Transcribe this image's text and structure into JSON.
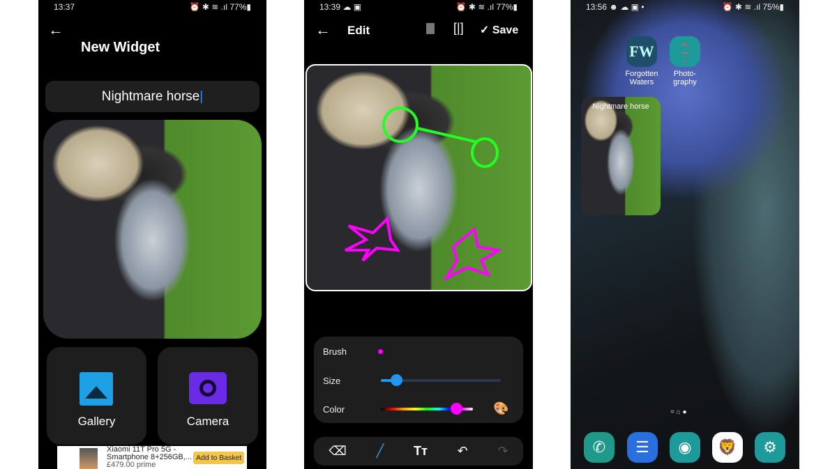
{
  "panel1": {
    "status": {
      "time": "13:37",
      "battery": "77%"
    },
    "title": "New Widget",
    "name_input": "Nightmare horse",
    "buttons": [
      {
        "label": "Gallery",
        "icon": "image-icon",
        "color": "#1ea0e6"
      },
      {
        "label": "Camera",
        "icon": "camera-icon",
        "color": "#6a2be6"
      }
    ],
    "ad": {
      "title": "Xiaomi 11T Pro 5G -",
      "subtitle": "Smartphone 8+256GB,...",
      "price": "£479.00 prime",
      "cta": "Add to Basket"
    }
  },
  "panel2": {
    "status": {
      "time": "13:39",
      "battery": "77%"
    },
    "title": "Edit",
    "save": "Save",
    "controls": {
      "brush_label": "Brush",
      "size_label": "Size",
      "color_label": "Color",
      "size_value": 0.13,
      "color_value": 0.82,
      "brush_color": "#f0f",
      "size_color": "#2196f3"
    },
    "tools": [
      "eraser-icon",
      "brush-icon",
      "text-icon",
      "undo-icon",
      "redo-icon"
    ]
  },
  "panel3": {
    "status": {
      "time": "13:56",
      "battery": "75%"
    },
    "apps": [
      {
        "label1": "Forgotten",
        "label2": "Waters"
      },
      {
        "label1": "Photo-",
        "label2": "graphy"
      }
    ],
    "widget_title": "Nightmare horse",
    "dock": [
      "phone-icon",
      "messages-icon",
      "camera-icon",
      "brave-browser-icon",
      "settings-icon"
    ]
  }
}
